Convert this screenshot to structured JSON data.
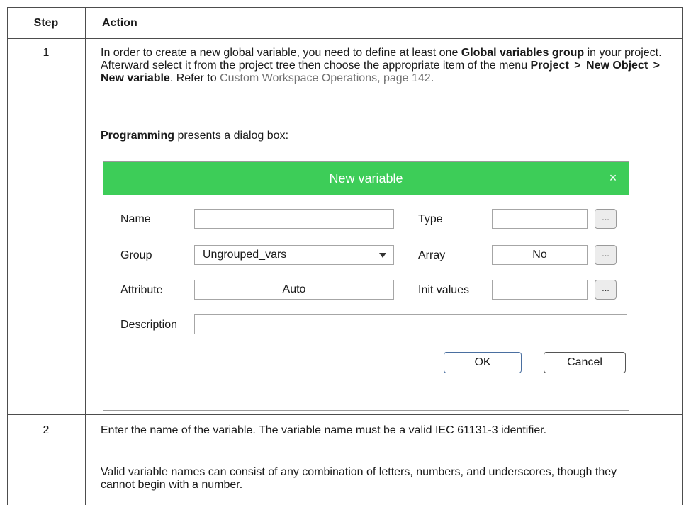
{
  "table": {
    "headers": {
      "step": "Step",
      "action": "Action"
    },
    "rows": [
      {
        "step": "1",
        "para1": {
          "t1": "In order to create a new global variable, you need to define at least one ",
          "b1": "Global variables group",
          "t2": " in your project. Afterward select it from the project tree then choose the appropriate item of the menu ",
          "b2": "Project",
          "sep1": ">",
          "b3": "New Object",
          "sep2": ">",
          "b4": "New variable",
          "t3": ". Refer to ",
          "link": "Custom Workspace Operations, page 142",
          "t4": "."
        },
        "para2": {
          "b1": "Programming",
          "t1": " presents a dialog box:"
        }
      },
      {
        "step": "2",
        "para1": "Enter the name of the variable. The variable name must be a valid IEC 61131-3 identifier.",
        "para2": "Valid variable names can consist of any combination of letters, numbers, and underscores, though they cannot begin with a number."
      }
    ]
  },
  "dialog": {
    "title": "New variable",
    "close_glyph": "×",
    "title_bar_color": "#3dcd58",
    "labels": {
      "name": "Name",
      "group": "Group",
      "attribute": "Attribute",
      "description": "Description",
      "type": "Type",
      "array": "Array",
      "init_values": "Init values"
    },
    "values": {
      "name": "",
      "group": "Ungrouped_vars",
      "attribute": "Auto",
      "description": "",
      "type": "",
      "array": "No",
      "init_values": ""
    },
    "ellipsis": "...",
    "ok_label": "OK",
    "cancel_label": "Cancel",
    "icons": {
      "close": "close-icon",
      "dropdown": "chevron-down-icon"
    }
  }
}
